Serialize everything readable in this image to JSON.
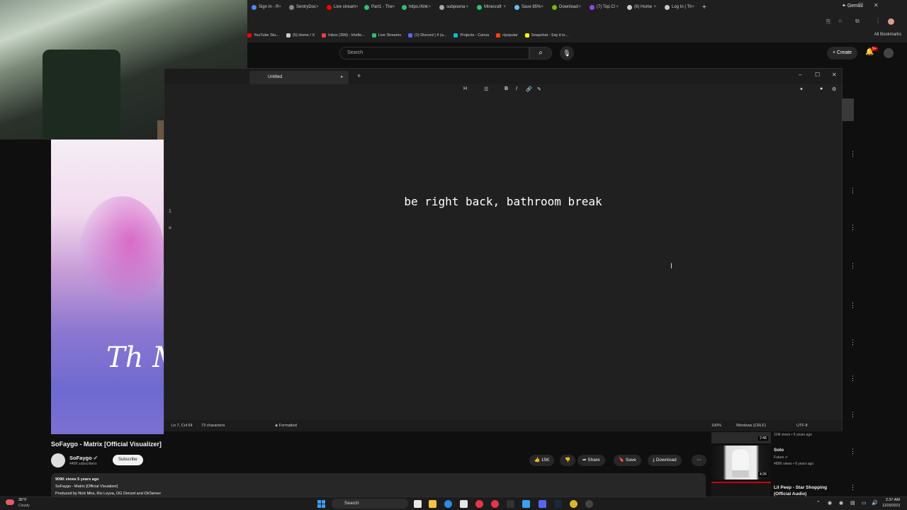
{
  "browser": {
    "tabs": [
      {
        "label": "Sign In - R",
        "color": "#4a8af4"
      },
      {
        "label": "SentryDoc",
        "color": "#888888"
      },
      {
        "label": "Live stream",
        "color": "#ff0000"
      },
      {
        "label": "Part1 - The",
        "color": "#2fbf71"
      },
      {
        "label": "https://link",
        "color": "#2fbf71"
      },
      {
        "label": "subpoena",
        "color": "#aaaaaa"
      },
      {
        "label": "Minecraft",
        "color": "#2fbf71"
      },
      {
        "label": "Save 85%",
        "color": "#66c0f4"
      },
      {
        "label": "Download",
        "color": "#76b900"
      },
      {
        "label": "(7) Top Cl",
        "color": "#9146ff"
      },
      {
        "label": "(6) Home",
        "color": "#cccccc"
      },
      {
        "label": "Log In | Th",
        "color": "#cccccc"
      }
    ],
    "new_tab": "+",
    "gemini": "Gemini",
    "bookmarks": [
      {
        "label": "YouTube Stu...",
        "color": "#ff0000"
      },
      {
        "label": "(5) Home / X",
        "color": "#cccccc"
      },
      {
        "label": "Inbox (399) - khelle...",
        "color": "#ea4335"
      },
      {
        "label": "Live Streams",
        "color": "#2fbf71"
      },
      {
        "label": "(1) Discord | # (a...",
        "color": "#5865f2"
      },
      {
        "label": "Projects - Canva",
        "color": "#00c4cc"
      },
      {
        "label": "r/popular",
        "color": "#ff4500"
      },
      {
        "label": "Snapchat - Say it in...",
        "color": "#fffc00"
      }
    ],
    "all_bookmarks": "All Bookmarks"
  },
  "youtube": {
    "search_placeholder": "Search",
    "create_label": "Create",
    "notif_count": "9+",
    "video_overlay": "Th Ma",
    "video_title": "SoFaygo - Matrix [Official Visualizer]",
    "channel_name": "SoFaygo",
    "subscribers": "446K subscribers",
    "subscribe_label": "Subscribe",
    "like_count": "15K",
    "share_label": "Share",
    "save_label": "Save",
    "download_label": "Download",
    "description": {
      "stats": "909K views  5 years ago",
      "line1": "SoFaygo - Matrix [Official Visualizer]",
      "line2": "Produced by Nick Mira, Rio Leyva, OG Denzel and OkTanner"
    },
    "related": [
      {
        "meta": "11M views • 5 years ago",
        "duration": "2:48"
      },
      {
        "title": "Solo",
        "artist": "Future",
        "meta": "468K views • 8 years ago",
        "duration": "4:26"
      },
      {
        "title": "Lil Peep - Star Shopping (Official Audio)"
      }
    ]
  },
  "editor": {
    "tab_title": "Untitled",
    "content": "be right back, bathroom break",
    "line_number": "1",
    "line_mark": "¤",
    "status": {
      "position": "Ln 7, Col 64",
      "chars": "73 characters",
      "format": "Formatted",
      "zoom": "100%",
      "line_ending": "Windows (CRLF)",
      "encoding": "UTF-8"
    },
    "toolbar": {
      "heading": "H",
      "list": "☰",
      "bold": "B",
      "italic": "I",
      "link": "🔗",
      "clear": "✎"
    }
  },
  "taskbar": {
    "weather_temp": "35°F",
    "weather_desc": "Cloudy",
    "search_label": "Search",
    "time": "2:37 AM",
    "date": "12/29/2023"
  }
}
